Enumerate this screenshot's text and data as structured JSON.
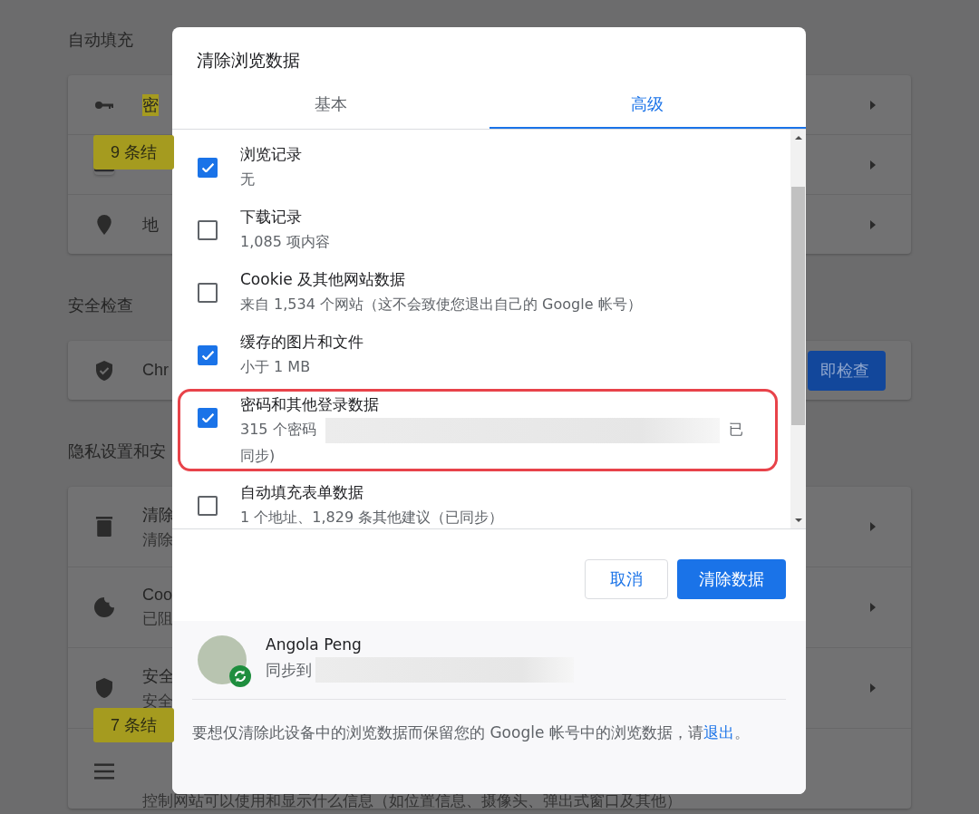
{
  "background": {
    "sections": [
      {
        "heading": "自动填充",
        "rows": [
          {
            "title": "密",
            "highlight": true,
            "tooltip": "9 条结",
            "arrow": true
          },
          {
            "arrow": true
          },
          {
            "title": "地",
            "highlight": false,
            "arrow": true
          }
        ]
      },
      {
        "heading": "安全检查",
        "rows": [
          {
            "title": "Chr",
            "highlight": false,
            "arrow": false,
            "action": "即检查"
          }
        ]
      },
      {
        "heading": "隐私设置和安",
        "rows": [
          {
            "title": "清除",
            "highlight": false,
            "subtitle": "清除",
            "arrow": true
          },
          {
            "title": "Coo",
            "highlight": false,
            "subtitle": "已阻",
            "arrow": true
          },
          {
            "title": "安全",
            "highlight": false,
            "subtitle": "安全",
            "tooltip": "7 条结",
            "arrow": true
          },
          {
            "subtitle": "控制网站可以使用和显示什么信息（如位置信息、摄像头、弹出式窗口及其他）",
            "arrow": false
          }
        ]
      }
    ]
  },
  "dialog": {
    "title": "清除浏览数据",
    "tabs": [
      {
        "label": "基本",
        "selected": false
      },
      {
        "label": "高级",
        "selected": true
      }
    ],
    "items": [
      {
        "title": "浏览记录",
        "subtitle": "无",
        "checked": true,
        "highlighted": false,
        "redacted": false
      },
      {
        "title": "下载记录",
        "subtitle": "1,085 项内容",
        "checked": false,
        "highlighted": false,
        "redacted": false
      },
      {
        "title": "Cookie 及其他网站数据",
        "subtitle": "来自 1,534 个网站（这不会致使您退出自己的 Google 帐号）",
        "checked": false,
        "highlighted": false,
        "redacted": false
      },
      {
        "title": "缓存的图片和文件",
        "subtitle": "小于 1 MB",
        "checked": true,
        "highlighted": false,
        "redacted": false
      },
      {
        "title": "密码和其他登录数据",
        "subtitle": "315 个密码",
        "checked": true,
        "highlighted": true,
        "redacted": true,
        "subtitle_after": "已同步)"
      },
      {
        "title": "自动填充表单数据",
        "subtitle": "1 个地址、1,829 条其他建议（已同步）",
        "checked": false,
        "highlighted": false,
        "redacted": false
      }
    ],
    "buttons": [
      {
        "label": "取消",
        "kind": "secondary"
      },
      {
        "label": "清除数据",
        "kind": "primary"
      }
    ],
    "account": {
      "name": "Angola Peng",
      "sync_label": "同步到"
    },
    "note": {
      "text": "要想仅清除此设备中的浏览数据而保留您的 Google 帐号中的浏览数据，请",
      "link": "退出",
      "after": "。"
    }
  }
}
